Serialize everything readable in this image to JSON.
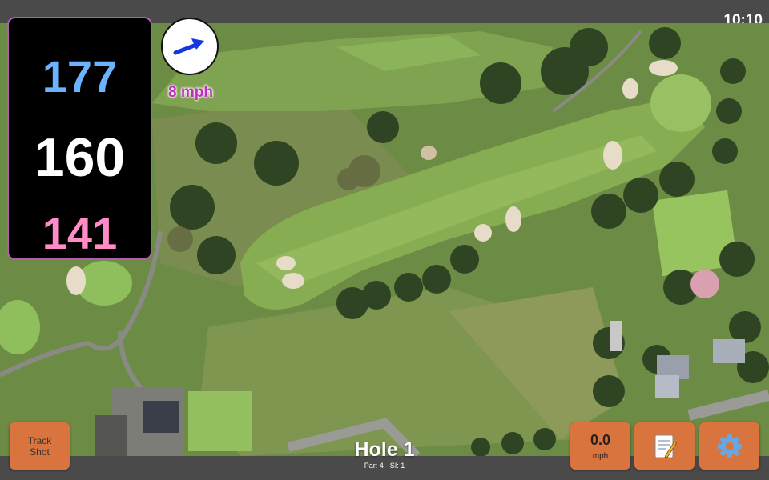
{
  "status_bar": {
    "time": "10:10"
  },
  "distances": {
    "back": "177",
    "center": "160",
    "front": "141"
  },
  "wind": {
    "speed_label": "8 mph",
    "direction_icon": "wind-arrow-icon"
  },
  "buttons": {
    "track_shot_line1": "Track",
    "track_shot_line2": "Shot",
    "shot_speed_value": "0.0",
    "shot_speed_unit": "mph",
    "notes_icon": "notepad-icon",
    "settings_icon": "gear-icon"
  },
  "hole": {
    "title": "Hole 1",
    "par": "Par: 4",
    "si": "SI: 1"
  },
  "colors": {
    "back_distance": "#6cb3ff",
    "center_distance": "#ffffff",
    "front_distance": "#ff8bc7",
    "wind_text": "#c02ec0",
    "button": "#d9743f"
  }
}
